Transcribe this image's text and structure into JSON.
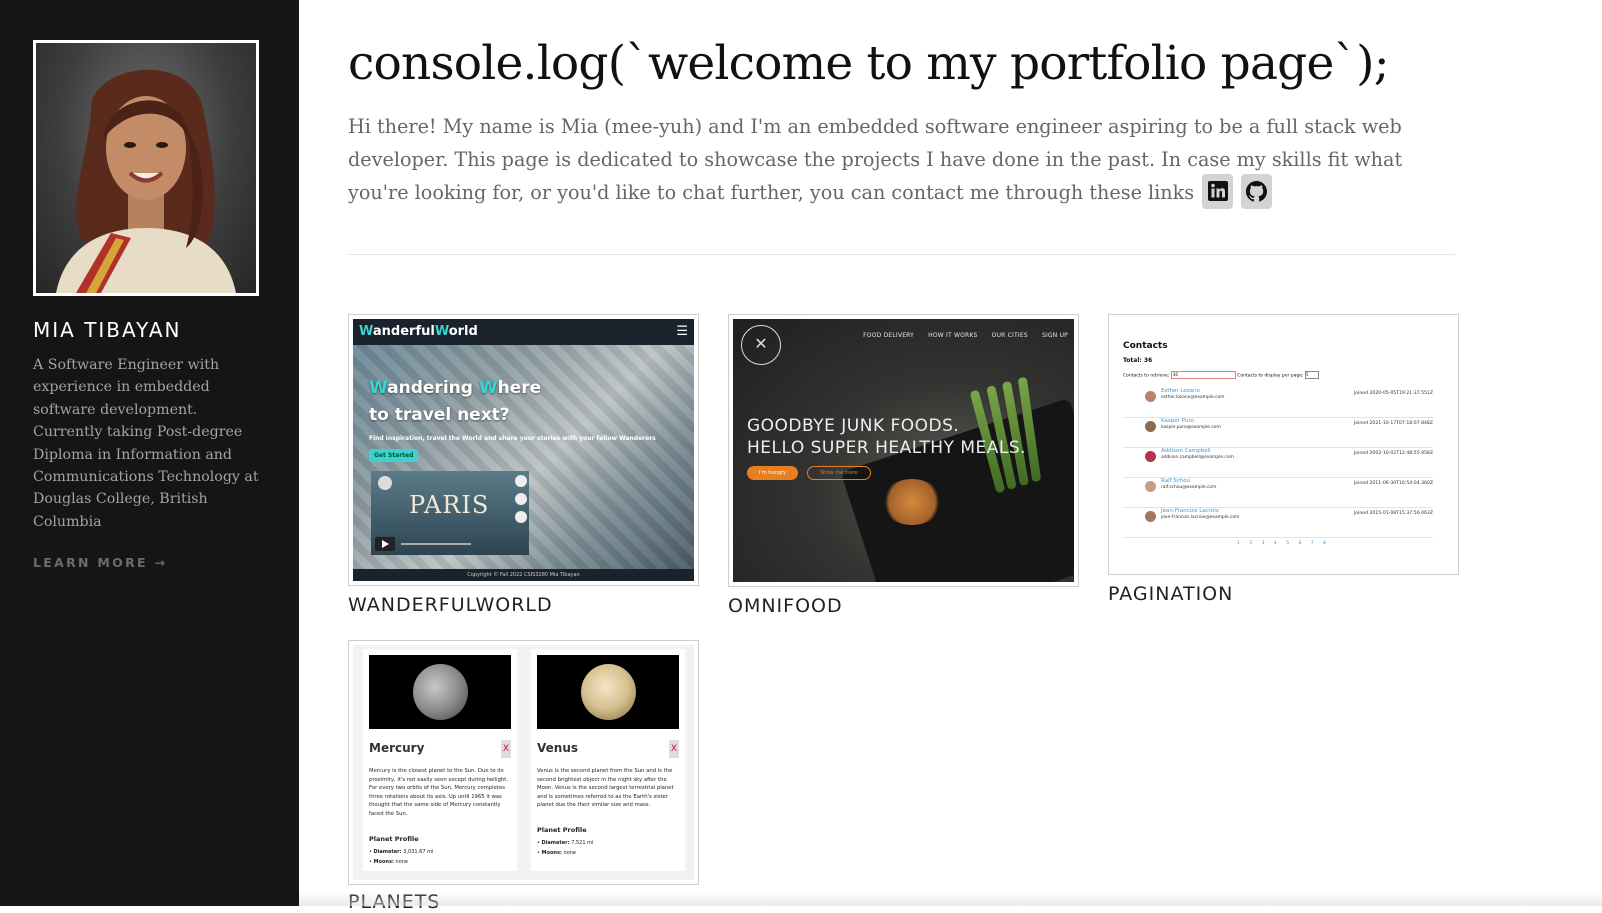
{
  "sidebar": {
    "name": "MIA TIBAYAN",
    "bio": "A Software Engineer with experience in embedded software development. Currently taking Post-degree Diploma in Information and Communications Technology at Douglas College, British Columbia",
    "learn_more": "LEARN MORE →"
  },
  "main": {
    "headline": "console.log(`welcome to my portfolio page`);",
    "intro": "Hi there! My name is Mia (mee-yuh) and I'm an embedded software engineer aspiring to be a full stack web developer. This page is dedicated to showcase the projects I have done in the past. In case my skills fit what you're looking for, or you'd like to chat further, you can contact me through these links",
    "links": [
      {
        "icon": "linkedin-icon"
      },
      {
        "icon": "github-icon"
      }
    ]
  },
  "projects": [
    {
      "title": "WANDERFULWORLD",
      "preview": {
        "brand_a": "W",
        "brand_b": "anderful",
        "brand_c": "W",
        "brand_d": "orld",
        "headline_l1_a": "W",
        "headline_l1_b": "andering ",
        "headline_l1_c": "W",
        "headline_l1_d": "here",
        "headline_l2": "to travel next?",
        "subtitle": "Find inspiration, travel the World and share your stories with your fellow Wanderers",
        "cta": "Get Started",
        "video_label": "PARIS",
        "footer": "Copyright © Fall 2022 CSIS3280 Mia Tibayan"
      }
    },
    {
      "title": "OMNIFOOD",
      "preview": {
        "nav": [
          "FOOD DELIVERY",
          "HOW IT WORKS",
          "OUR CITIES",
          "SIGN UP"
        ],
        "headline_l1": "GOODBYE JUNK FOODS.",
        "headline_l2": "HELLO SUPER HEALTHY MEALS.",
        "btn_primary": "I'm hungry",
        "btn_secondary": "Show me more"
      }
    },
    {
      "title": "PAGINATION",
      "preview": {
        "heading": "Contacts",
        "total": "Total: 36",
        "retrieve_label": "Contacts to retrieve:",
        "retrieve_value": "36",
        "per_page_label": "Contacts to display per page:",
        "per_page_value": "5",
        "rows": [
          {
            "name": "Esther Lozano",
            "email": "esther.lozano@example.com",
            "joined": "Joined 2020-05-05T19:21:37.551Z"
          },
          {
            "name": "Kasper Puro",
            "email": "kasper.puro@example.com",
            "joined": "Joined 2021-10-17T07:18:07.848Z"
          },
          {
            "name": "Addison Campbell",
            "email": "addison.campbell@example.com",
            "joined": "Joined 2002-10-02T12:48:55.958Z"
          },
          {
            "name": "Ralf Schou",
            "email": "ralf.schou@example.com",
            "joined": "Joined 2011-06-30T16:54:04.360Z"
          },
          {
            "name": "Jean-Francois Lacroix",
            "email": "jean-francois.lacroix@example.com",
            "joined": "Joined 2015-01-08T15:37:56.063Z"
          }
        ],
        "pages": "1 2 3 4 5 6 7 8"
      }
    },
    {
      "title": "PLANETS",
      "preview": {
        "planets": [
          {
            "name": "Mercury",
            "close": "X",
            "description": "Mercury is the closest planet to the Sun. Due to its proximity, it's not easily seen except during twilight. For every two orbits of the Sun, Mercury completes three rotations about its axis. Up until 1965 it was thought that the same side of Mercury constantly faced the Sun.",
            "profile_heading": "Planet Profile",
            "diameter_label": "Diameter:",
            "diameter": "3,031.67 mi",
            "moons_label": "Moons:",
            "moons": "none"
          },
          {
            "name": "Venus",
            "close": "X",
            "description": "Venus is the second planet from the Sun and is the second brightest object in the night sky after the Moon. Venus is the second largest terrestrial planet and is sometimes referred to as the Earth's sister planet due the their similar size and mass.",
            "profile_heading": "Planet Profile",
            "diameter_label": "Diameter:",
            "diameter": "7,521 mi",
            "moons_label": "Moons:",
            "moons": "none"
          }
        ]
      }
    }
  ],
  "colors": {
    "sidebar_bg": "#151515",
    "accent_teal": "#39d3d0",
    "accent_orange": "#e67e22",
    "link_blue": "#3f9bd0"
  }
}
